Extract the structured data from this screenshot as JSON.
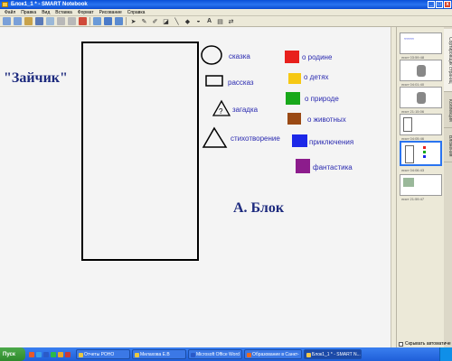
{
  "window": {
    "title": "Блок1_1 * - SMART Notebook",
    "controls": {
      "minimize": "_",
      "maximize": "□",
      "close": "x"
    }
  },
  "menu": [
    "Файл",
    "Правка",
    "Вид",
    "Вставка",
    "Формат",
    "Рисование",
    "Справка"
  ],
  "canvas": {
    "title": "\"Зайчик\"",
    "author": "А. Блок",
    "shapes": [
      {
        "label": "сказка",
        "shape": "circle"
      },
      {
        "label": "рассказ",
        "shape": "rectangle"
      },
      {
        "label": "загадка",
        "shape": "triangle-question"
      },
      {
        "label": "стихотворение",
        "shape": "triangle"
      }
    ],
    "legend": [
      {
        "label": "о родине",
        "color": "#e8201c"
      },
      {
        "label": "о детях",
        "color": "#f6c814"
      },
      {
        "label": "о природе",
        "color": "#18a81a"
      },
      {
        "label": "о животных",
        "color": "#9a4a14"
      },
      {
        "label": "приключения",
        "color": "#1c28e8"
      },
      {
        "label": "фантастика",
        "color": "#8c1c8c"
      }
    ]
  },
  "sidebar": {
    "tabs": [
      "Сортировщик страниц",
      "Коллекция",
      "Вложения"
    ],
    "thumbnails": [
      {
        "label": "лист 03:59:48"
      },
      {
        "label": "лист 04:01:40"
      },
      {
        "label": "лист 21:15:06"
      },
      {
        "label": "лист 04:05:46"
      },
      {
        "label": "лист 04:06:43"
      },
      {
        "label": "лист 21:59:47"
      }
    ],
    "autohide": "Скрывать автоматиче"
  },
  "taskbar": {
    "start": "Пуск",
    "tasks": [
      {
        "label": "Отчеты РОНО",
        "color": "#e8c840"
      },
      {
        "label": "Милахова Е.В",
        "color": "#e8c840"
      },
      {
        "label": "Microsoft Office Word",
        "color": "#2a5ac8"
      },
      {
        "label": "Образование в Санкт-",
        "color": "#e86820"
      },
      {
        "label": "Блок1_1 * - SMART N...",
        "color": "#f6c94a"
      }
    ]
  }
}
